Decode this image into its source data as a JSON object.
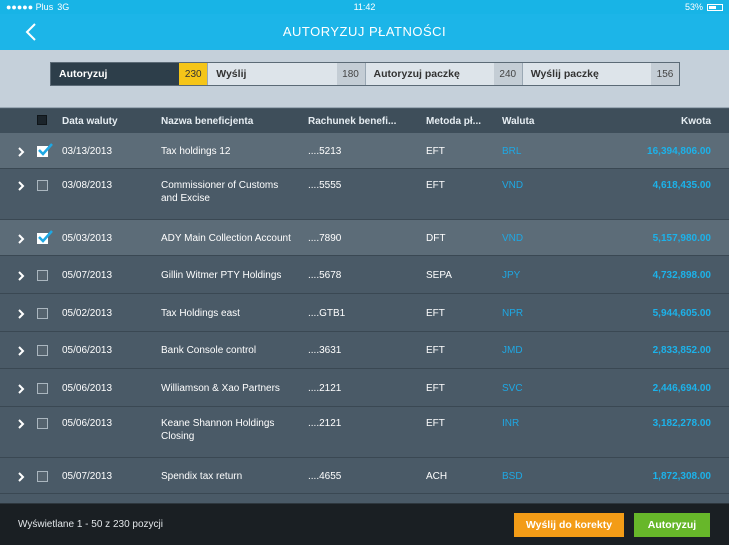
{
  "statusbar": {
    "carrier": "●●●●● Plus",
    "network": "3G",
    "time": "11:42",
    "battery": "53%"
  },
  "navbar": {
    "title": "AUTORYZUJ PŁATNOŚCI",
    "back_icon": "chevron-left-icon"
  },
  "tabs": [
    {
      "label": "Autoryzuj",
      "count": "230",
      "active": true
    },
    {
      "label": "Wyślij",
      "count": "180",
      "active": false
    },
    {
      "label": "Autoryzuj paczkę",
      "count": "240",
      "active": false
    },
    {
      "label": "Wyślij paczkę",
      "count": "156",
      "active": false
    }
  ],
  "table": {
    "headers": {
      "date": "Data waluty",
      "beneficiary": "Nazwa beneficjenta",
      "account": "Rachunek benefi...",
      "method": "Metoda pł...",
      "currency": "Waluta",
      "amount": "Kwota"
    },
    "rows": [
      {
        "date": "03/13/2013",
        "name1": "Tax holdings 12",
        "name2": "",
        "account": "....5213",
        "method": "EFT",
        "currency": "BRL",
        "amount": "16,394,806.00",
        "checked": true
      },
      {
        "date": "03/08/2013",
        "name1": "Commissioner of Customs",
        "name2": "and Excise",
        "account": "....5555",
        "method": "EFT",
        "currency": "VND",
        "amount": "4,618,435.00",
        "checked": false
      },
      {
        "date": "05/03/2013",
        "name1": "ADY Main Collection Account",
        "name2": "",
        "account": "....7890",
        "method": "DFT",
        "currency": "VND",
        "amount": "5,157,980.00",
        "checked": true
      },
      {
        "date": "05/07/2013",
        "name1": "Gillin Witmer PTY Holdings",
        "name2": "",
        "account": "....5678",
        "method": "SEPA",
        "currency": "JPY",
        "amount": "4,732,898.00",
        "checked": false
      },
      {
        "date": "05/02/2013",
        "name1": "Tax Holdings east",
        "name2": "",
        "account": "....GTB1",
        "method": "EFT",
        "currency": "NPR",
        "amount": "5,944,605.00",
        "checked": false
      },
      {
        "date": "05/06/2013",
        "name1": "Bank Console control",
        "name2": "",
        "account": "....3631",
        "method": "EFT",
        "currency": "JMD",
        "amount": "2,833,852.00",
        "checked": false
      },
      {
        "date": "05/06/2013",
        "name1": "Williamson & Xao Partners",
        "name2": "",
        "account": "....2121",
        "method": "EFT",
        "currency": "SVC",
        "amount": "2,446,694.00",
        "checked": false
      },
      {
        "date": "05/06/2013",
        "name1": "Keane Shannon Holdings",
        "name2": "Closing",
        "account": "....2121",
        "method": "EFT",
        "currency": "INR",
        "amount": "3,182,278.00",
        "checked": false
      },
      {
        "date": "05/07/2013",
        "name1": "Spendix tax return",
        "name2": "",
        "account": "....4655",
        "method": "ACH",
        "currency": "BSD",
        "amount": "1,872,308.00",
        "checked": false
      }
    ]
  },
  "footer": {
    "info": "Wyświetlane 1 - 50 z 230 pozycji",
    "correct_button": "Wyślij do korekty",
    "authorize_button": "Autoryzuj"
  },
  "colors": {
    "accent": "#1cb5e8",
    "active_count": "#f5c518",
    "orange": "#f39c17",
    "green": "#67b72a",
    "currency": "#1ea8e4"
  }
}
